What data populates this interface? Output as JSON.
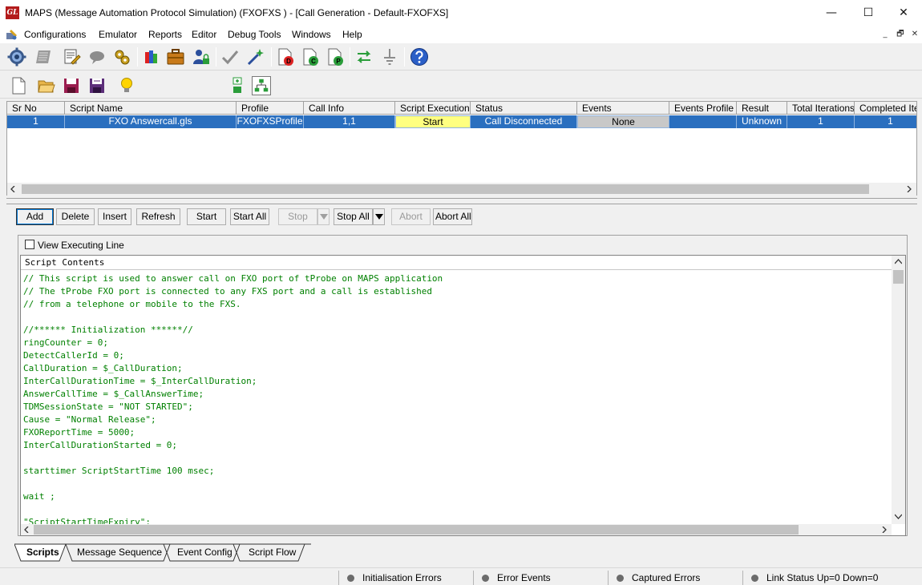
{
  "window": {
    "title": "MAPS (Message Automation Protocol Simulation)  (FXOFXS ) - [Call Generation  - Default-FXOFXS]",
    "logo_text": "GL",
    "controls": {
      "minimize": "—",
      "maximize": "☐",
      "close": "✕"
    }
  },
  "menu": {
    "items": [
      "Configurations",
      "Emulator",
      "Reports",
      "Editor",
      "Debug Tools",
      "Windows",
      "Help"
    ],
    "mdi_controls": {
      "minimize": "_",
      "restore": "🗗",
      "close": "✕"
    }
  },
  "toolbar1": {
    "icons": [
      "configuration-gear-icon",
      "script-list-icon",
      "profile-edit-icon",
      "message-icon",
      "tools-icon",
      "database-icon",
      "briefcase-icon",
      "user-lock-icon",
      "check-icon",
      "wizard-icon",
      "document-d-icon",
      "document-c-icon",
      "document-p-icon",
      "call-flow-icon",
      "ground-icon",
      "help-icon"
    ],
    "doc_letters": [
      "D",
      "C",
      "P"
    ]
  },
  "toolbar2": {
    "icons": [
      "new-file-icon",
      "open-folder-icon",
      "save-icon",
      "save-as-icon",
      "bulb-icon",
      "expand-icon",
      "tree-icon"
    ]
  },
  "grid": {
    "columns": [
      "Sr No",
      "Script Name",
      "Profile",
      "Call Info",
      "Script Execution",
      "Status",
      "Events",
      "Events Profile",
      "Result",
      "Total Iterations",
      "Completed Itera"
    ],
    "rows": [
      {
        "sr_no": "1",
        "script_name": "FXO Answercall.gls",
        "profile": "FXOFXSProfile",
        "call_info": "1,1",
        "script_execution": "Start",
        "status": "Call Disconnected",
        "events": "None",
        "events_profile": "",
        "result": "Unknown",
        "total_iterations": "1",
        "completed_iterations": "1"
      }
    ],
    "colors": {
      "selected_row": "#2a6fbf",
      "execution_cell": "#ffff80",
      "events_cell": "#c8c8c8"
    }
  },
  "buttons": {
    "add": "Add",
    "delete": "Delete",
    "insert": "Insert",
    "refresh": "Refresh",
    "start": "Start",
    "start_all": "Start All",
    "stop": "Stop",
    "stop_all": "Stop All",
    "abort": "Abort",
    "abort_all": "Abort All"
  },
  "script_panel": {
    "view_executing_line_label": "View Executing Line",
    "view_executing_line_checked": false,
    "header": "Script Contents",
    "code_lines": [
      "// This script is used to answer call on FXO port of tProbe on MAPS application",
      "// The tProbe FXO port is connected to any FXS port and a call is established",
      "// from a telephone or mobile to the FXS.",
      "",
      "//****** Initialization ******//",
      "ringCounter = 0;",
      "DetectCallerId = 0;",
      "CallDuration = $_CallDuration;",
      "InterCallDurationTime = $_InterCallDuration;",
      "AnswerCallTime = $_CallAnswerTime;",
      "TDMSessionState = \"NOT STARTED\";",
      "Cause = \"Normal Release\";",
      "FXOReportTime = 5000;",
      "InterCallDurationStarted = 0;",
      "",
      "starttimer ScriptStartTime 100 msec;",
      "",
      "wait ;",
      "",
      "\"ScriptStartTimeExpiry\":"
    ],
    "code_color": "#008000"
  },
  "tabs": [
    "Scripts",
    "Message Sequence",
    "Event Config",
    "Script Flow"
  ],
  "active_tab": "Scripts",
  "statusbar": {
    "items": [
      "Initialisation Errors",
      "Error Events",
      "Captured Errors",
      "Link Status Up=0 Down=0"
    ]
  }
}
